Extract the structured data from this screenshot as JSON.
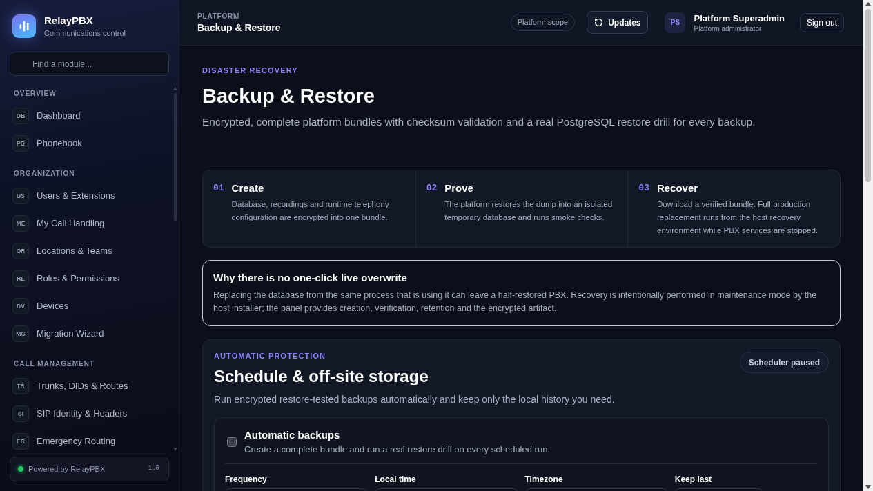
{
  "sidebar": {
    "brand": {
      "name": "RelayPBX",
      "tagline": "Communications control"
    },
    "search": {
      "placeholder": "Find a module..."
    },
    "sections": [
      {
        "heading": "OVERVIEW",
        "items": [
          {
            "code": "DB",
            "label": "Dashboard",
            "selected": false
          },
          {
            "code": "PB",
            "label": "Phonebook",
            "selected": false
          }
        ]
      },
      {
        "heading": "ORGANIZATION",
        "items": [
          {
            "code": "US",
            "label": "Users & Extensions",
            "selected": false
          },
          {
            "code": "ME",
            "label": "My Call Handling",
            "selected": false
          },
          {
            "code": "OR",
            "label": "Locations & Teams",
            "selected": false
          },
          {
            "code": "RL",
            "label": "Roles & Permissions",
            "selected": false
          },
          {
            "code": "DV",
            "label": "Devices",
            "selected": false
          },
          {
            "code": "MG",
            "label": "Migration Wizard",
            "selected": false
          }
        ]
      },
      {
        "heading": "CALL MANAGEMENT",
        "items": [
          {
            "code": "TR",
            "label": "Trunks, DIDs & Routes",
            "selected": false
          },
          {
            "code": "SI",
            "label": "SIP Identity & Headers",
            "selected": false
          },
          {
            "code": "ER",
            "label": "Emergency Routing",
            "selected": false
          }
        ]
      }
    ],
    "footer": {
      "text": "Powered by RelayPBX",
      "version": "1.0"
    }
  },
  "header": {
    "eyebrow": "PLATFORM",
    "title": "Backup & Restore",
    "scope_badge": "Platform scope",
    "updates_button": "Updates",
    "user": {
      "initials": "PS",
      "name": "Platform Superadmin",
      "role": "Platform administrator"
    },
    "sign_out_button": "Sign out"
  },
  "hero": {
    "eyebrow": "DISASTER RECOVERY",
    "title": "Backup & Restore",
    "description": "Encrypted, complete platform bundles with checksum validation and a real PostgreSQL restore drill for every backup."
  },
  "steps": [
    {
      "number": "01",
      "title": "Create",
      "description": "Database, recordings and runtime telephony configuration are encrypted into one bundle."
    },
    {
      "number": "02",
      "title": "Prove",
      "description": "The platform restores the dump into an isolated temporary database and runs smoke checks."
    },
    {
      "number": "03",
      "title": "Recover",
      "description": "Download a verified bundle. Full production replacement runs from the host recovery environment while PBX services are stopped."
    }
  ],
  "notice": {
    "title": "Why there is no one-click live overwrite",
    "body": "Replacing the database from the same process that is using it can leave a half-restored PBX. Recovery is intentionally performed in maintenance mode by the host installer; the panel provides creation, verification, retention and the encrypted artifact."
  },
  "schedule": {
    "eyebrow": "AUTOMATIC PROTECTION",
    "title": "Schedule & off-site storage",
    "status_badge": "Scheduler paused",
    "description": "Run encrypted restore-tested backups automatically and keep only the local history you need.",
    "automatic_backups": {
      "label": "Automatic backups",
      "description": "Create a complete bundle and run a real restore drill on every scheduled run.",
      "checked": false
    },
    "fields": [
      {
        "label": "Frequency"
      },
      {
        "label": "Local time"
      },
      {
        "label": "Timezone"
      },
      {
        "label": "Keep last"
      }
    ]
  }
}
